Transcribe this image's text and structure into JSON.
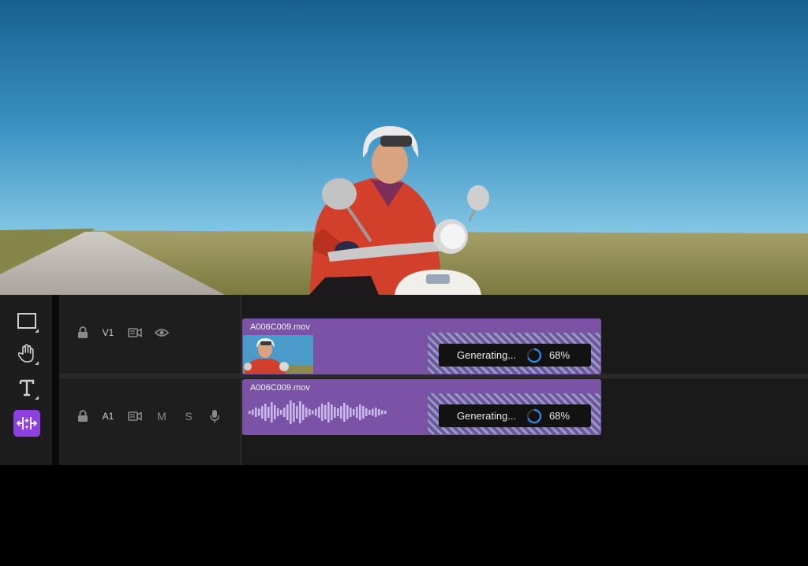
{
  "preview": {
    "scene": "rider-on-scooter",
    "colors": {
      "sky_top": "#1c6b9e",
      "sky_horizon": "#7cc3e6",
      "field": "#8e8a4c",
      "road": "#b7b3ad",
      "jacket": "#d2402c"
    }
  },
  "toolbar": {
    "tools": [
      {
        "name": "selection-tool",
        "icon": "rectangle-icon"
      },
      {
        "name": "hand-tool",
        "icon": "hand-icon"
      },
      {
        "name": "type-tool",
        "icon": "text-icon"
      },
      {
        "name": "generative-extend-tool",
        "icon": "extend-icon",
        "active": true
      }
    ],
    "active_color": "#8d3fe0"
  },
  "tracks": {
    "video": {
      "label": "V1",
      "icons": [
        "lock-icon",
        "camera-icon",
        "eye-icon"
      ],
      "clip": {
        "name": "A006C009.mov",
        "status": "Generating...",
        "progress": "68%"
      }
    },
    "audio": {
      "label": "A1",
      "mute": "M",
      "solo": "S",
      "icons": [
        "lock-icon",
        "camera-icon",
        "microphone-icon"
      ],
      "clip": {
        "name": "A006C009.mov",
        "status": "Generating...",
        "progress": "68%"
      }
    },
    "clip_color": "#7a52a6"
  }
}
